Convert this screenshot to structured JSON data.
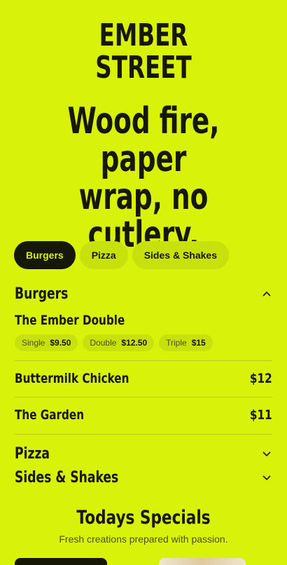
{
  "brand": {
    "line1": "EMBER",
    "line2": "STREET"
  },
  "headline": {
    "line1": "Wood fire, paper",
    "line2": "wrap, no",
    "line3": "cutlery."
  },
  "tabs": [
    {
      "label": "Burgers",
      "active": true
    },
    {
      "label": "Pizza",
      "active": false
    },
    {
      "label": "Sides & Shakes",
      "active": false
    }
  ],
  "menu": {
    "burgers": {
      "title": "Burgers",
      "expanded": true,
      "items": [
        {
          "name": "The Ember Double",
          "variants": [
            {
              "name": "Single",
              "price": "$9.50"
            },
            {
              "name": "Double",
              "price": "$12.50"
            },
            {
              "name": "Triple",
              "price": "$15"
            }
          ]
        },
        {
          "name": "Buttermilk Chicken",
          "price": "$12"
        },
        {
          "name": "The Garden",
          "price": "$11"
        }
      ]
    },
    "pizza": {
      "title": "Pizza",
      "expanded": false
    },
    "sides": {
      "title": "Sides & Shakes",
      "expanded": false
    }
  },
  "specials": {
    "title": "Todays Specials",
    "subtitle": "Fresh creations prepared with passion."
  },
  "colors": {
    "background": "#d9f20a",
    "ink": "#171706",
    "pill": "#c8e00c"
  },
  "icons": {
    "collapse": "chevron-up-icon",
    "expand": "chevron-down-icon"
  }
}
